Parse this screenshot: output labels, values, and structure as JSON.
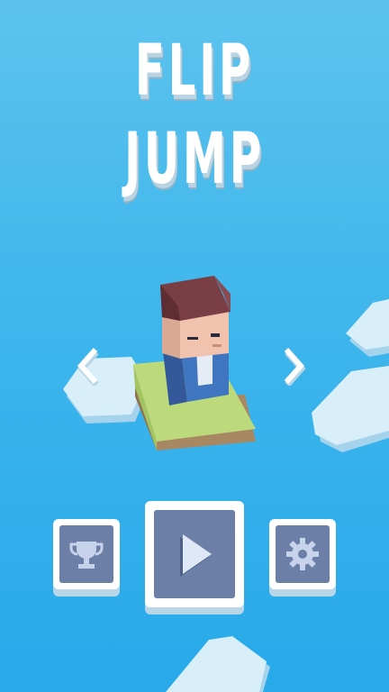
{
  "title": {
    "line1": "FLIP",
    "line2": "JUMP"
  },
  "character_select": {
    "prev_icon": "chevron-left-icon",
    "next_icon": "chevron-right-icon"
  },
  "buttons": {
    "leaderboard": {
      "icon": "trophy-icon"
    },
    "play": {
      "icon": "play-icon"
    },
    "settings": {
      "icon": "gear-icon"
    }
  },
  "colors": {
    "sky_top": "#5cc3ee",
    "sky_bottom": "#27a9ea",
    "button_face": "#6c7fa6",
    "button_frame": "#ffffff",
    "platform_grass": "#b8d577",
    "platform_dirt": "#b1956e",
    "hair": "#7a3f45",
    "jacket": "#3f6fb2"
  }
}
